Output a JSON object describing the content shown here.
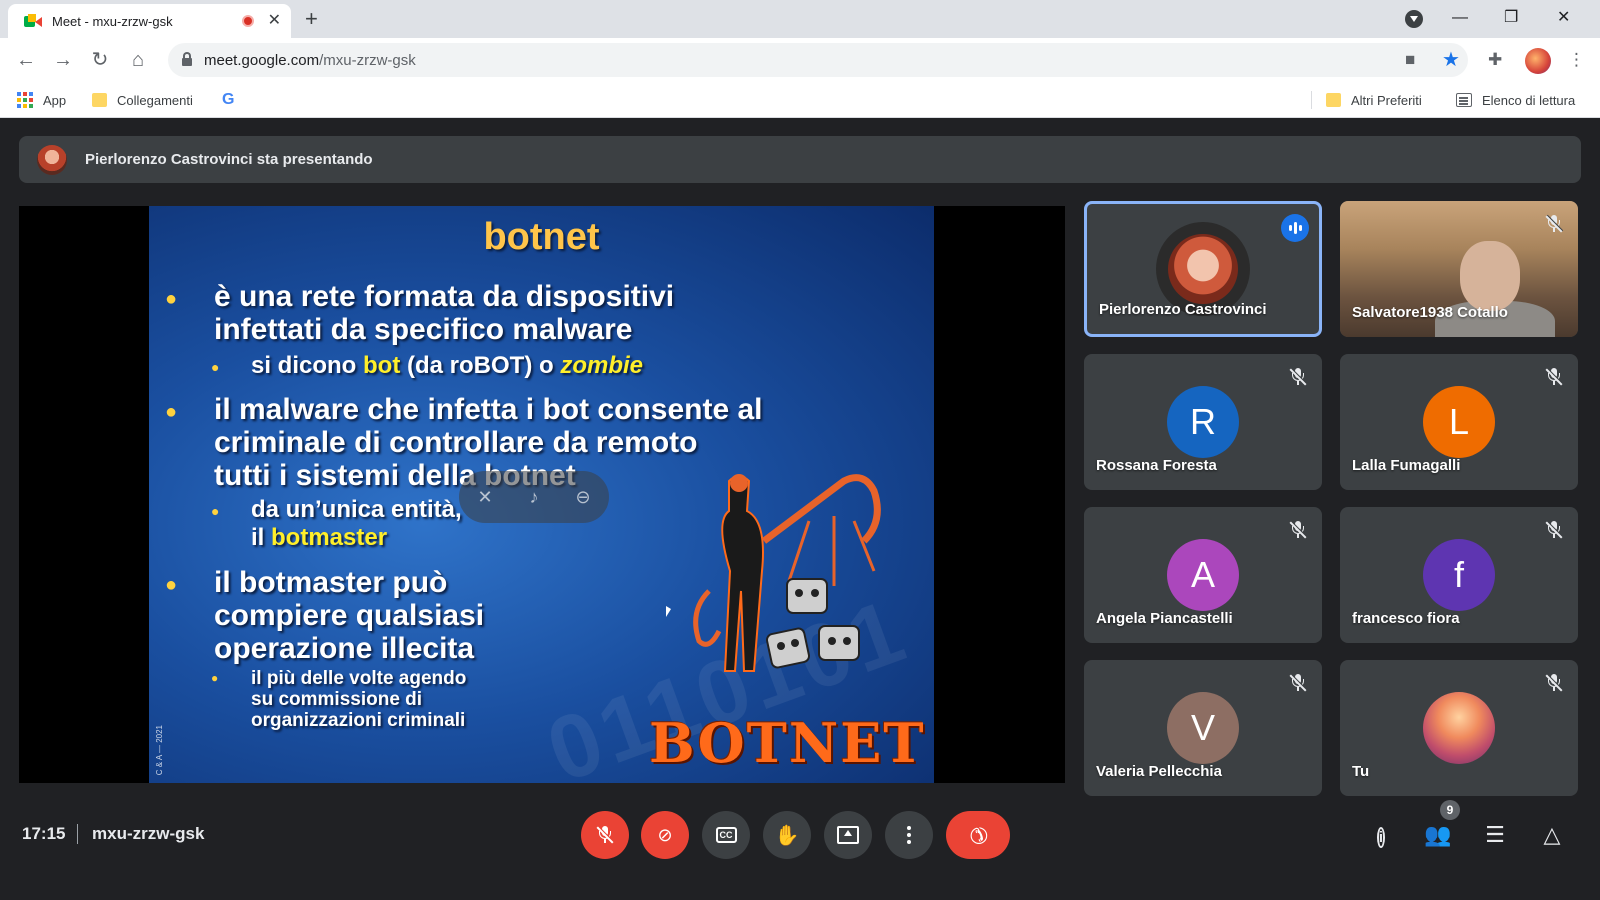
{
  "browser": {
    "tab_title": "Meet - mxu-zrzw-gsk",
    "tab_close": "✕",
    "new_tab": "+",
    "url_host": "meet.google.com",
    "url_path": "/mxu-zrzw-gsk",
    "bookmarks": [
      {
        "label": "App",
        "icon": "apps-grid-icon"
      },
      {
        "label": "Collegamenti",
        "icon": "folder-icon"
      },
      {
        "label": "",
        "icon": "google-icon"
      }
    ],
    "bookmarks_right": [
      {
        "label": "Altri Preferiti",
        "icon": "folder-icon"
      },
      {
        "label": "Elenco di lettura",
        "icon": "reading-list-icon"
      }
    ],
    "google_letter": "G"
  },
  "meet": {
    "presenting_text": "Pierlorenzo Castrovinci sta presentando",
    "slide": {
      "title": "botnet",
      "b1_line1": "è una rete formata da dispositivi",
      "b1_line2": "infettati da specifico malware",
      "b1_sub_pre": "si dicono ",
      "b1_sub_bot": "bot",
      "b1_sub_mid": " (da roBOT) o ",
      "b1_sub_zombie": "zombie",
      "b2_line1": "il malware che infetta i bot consente al",
      "b2_line2": "criminale di controllare da remoto",
      "b2_line3": "tutti i sistemi della botnet",
      "b2_sub_line1": "da un’unica entità,",
      "b2_sub_pre": "il ",
      "b2_sub_botmaster": "botmaster",
      "b3_line1": "il botmaster può",
      "b3_line2": "compiere qualsiasi",
      "b3_line3": "operazione illecita",
      "b3_sub_line1": "il più delle volte agendo",
      "b3_sub_line2": "su commissione di",
      "b3_sub_line3": "organizzazioni criminali",
      "illustration_text": "BOTNET",
      "watermark": "0110101",
      "copyright": "C & A — 2021"
    },
    "participants": [
      {
        "name": "Pierlorenzo Castrovinci",
        "speaking": true
      },
      {
        "name": "Salvatore1938 Cotallo",
        "muted": true
      },
      {
        "name": "Rossana Foresta",
        "initial": "R",
        "color": "#1565c0",
        "muted": true
      },
      {
        "name": "Lalla Fumagalli",
        "initial": "L",
        "color": "#ef6c00",
        "muted": true
      },
      {
        "name": "Angela Piancastelli",
        "initial": "A",
        "color": "#ab47bc",
        "muted": true
      },
      {
        "name": "francesco fiora",
        "initial": "f",
        "color": "#5e35b1",
        "muted": true
      },
      {
        "name": "Valeria Pellecchia",
        "initial": "V",
        "color": "#8d6e63",
        "muted": true
      },
      {
        "name": "Tu",
        "muted": true
      }
    ],
    "bottom": {
      "time": "17:15",
      "meeting_code": "mxu-zrzw-gsk",
      "people_count": "9",
      "cc_label": "CC"
    }
  }
}
